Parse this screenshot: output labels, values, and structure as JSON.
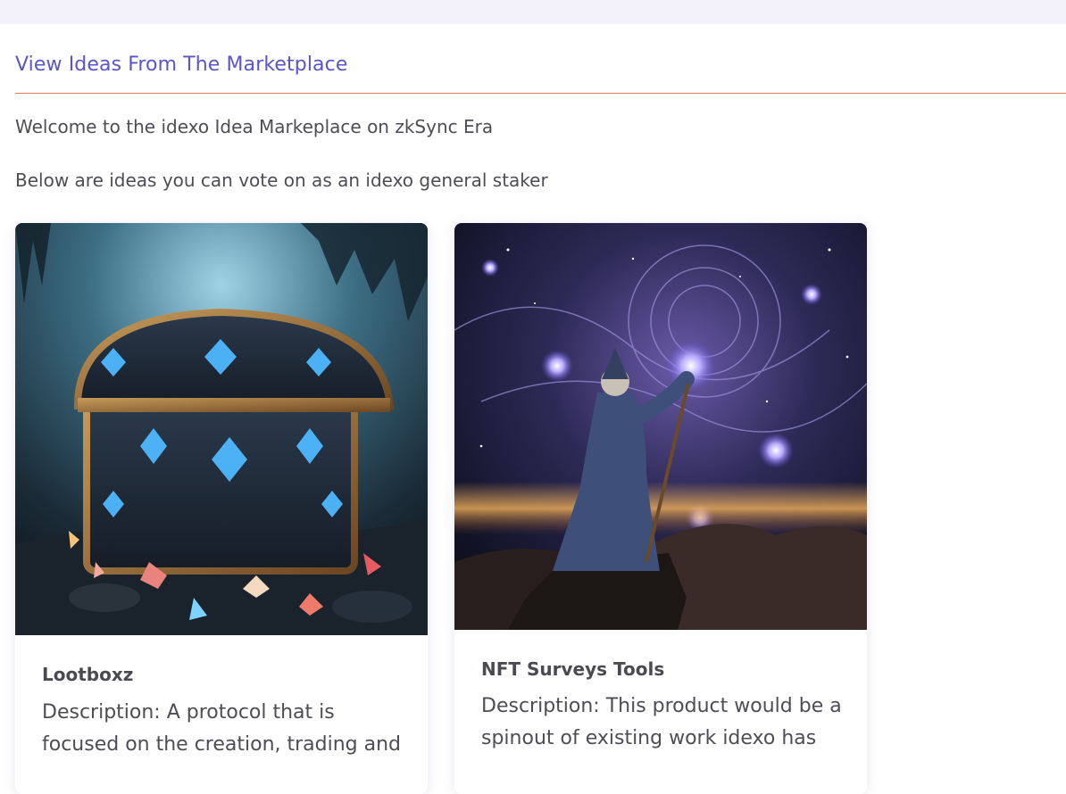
{
  "page": {
    "title": "View Ideas From The Marketplace",
    "intro_line_1": "Welcome to the idexo Idea Markeplace on zkSync Era",
    "intro_line_2": "Below are ideas you can vote on as an idexo general staker"
  },
  "colors": {
    "title": "#5a55c9",
    "divider": "#e07a5f",
    "topbar": "#f3f2fa"
  },
  "ideas": [
    {
      "name": "Lootboxz",
      "description": "Description: A protocol that is focused on the creation, trading and",
      "image": "treasure-chest-image"
    },
    {
      "name": "NFT Surveys Tools",
      "description": "Description: This product would be a spinout of existing work idexo has",
      "image": "wizard-cosmos-image"
    }
  ]
}
